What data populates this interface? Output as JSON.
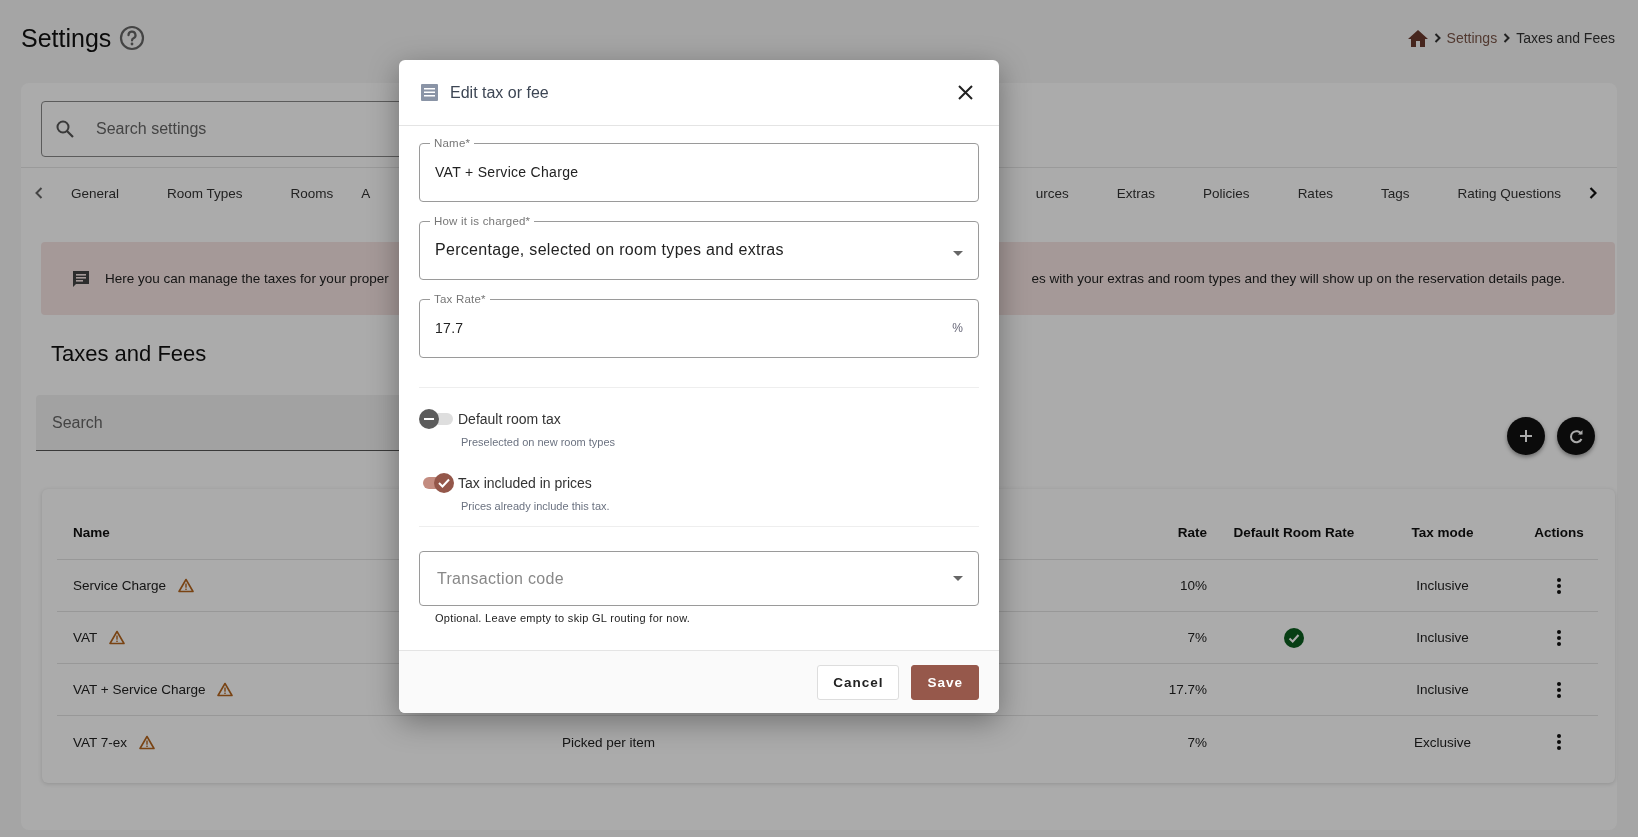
{
  "page": {
    "title": "Settings",
    "breadcrumb": [
      {
        "label": "Settings",
        "current": false
      },
      {
        "label": "Taxes and Fees",
        "current": true
      }
    ]
  },
  "settings_search": {
    "placeholder": "Search settings"
  },
  "tabs": {
    "left": [
      {
        "label": "General"
      },
      {
        "label": "Room Types"
      },
      {
        "label": "Rooms"
      },
      {
        "label": "A"
      }
    ],
    "right": [
      {
        "label": "urces"
      },
      {
        "label": "Extras"
      },
      {
        "label": "Policies"
      },
      {
        "label": "Rates"
      },
      {
        "label": "Tags"
      },
      {
        "label": "Rating Questions"
      }
    ]
  },
  "info_banner": {
    "text_parts": [
      "Here you can manage the taxes for your proper",
      "es with your extras and room types and they will show up on the reservation details page."
    ]
  },
  "section_title": "Taxes and Fees",
  "table_search": {
    "placeholder": "Search"
  },
  "table": {
    "header": {
      "name": "Name",
      "rate": "Rate",
      "default_room_rate": "Default Room Rate",
      "tax_mode": "Tax mode",
      "actions": "Actions"
    },
    "rows": [
      {
        "name": "Service Charge",
        "rate": "10%",
        "default_room_rate": false,
        "tax_mode": "Inclusive"
      },
      {
        "name": "VAT",
        "rate": "7%",
        "default_room_rate": true,
        "tax_mode": "Inclusive"
      },
      {
        "name": "VAT + Service Charge",
        "rate": "17.7%",
        "default_room_rate": false,
        "tax_mode": "Inclusive"
      },
      {
        "name": "VAT 7-ex",
        "column_2": "Picked per item",
        "rate": "7%",
        "default_room_rate": false,
        "tax_mode": "Exclusive"
      }
    ]
  },
  "dialog": {
    "title": "Edit tax or fee",
    "fields": [
      {
        "kind": "text",
        "label": "Name*",
        "value": "VAT + Service Charge"
      },
      {
        "kind": "select",
        "label": "How it is charged*",
        "value": "Percentage, selected on room types and extras"
      },
      {
        "kind": "text",
        "label": "Tax Rate*",
        "value": "17.7",
        "suffix": "%"
      }
    ],
    "toggles": [
      {
        "label": "Default room tax",
        "hint": "Preselected on new room types",
        "checked": false
      },
      {
        "label": "Tax included in prices",
        "hint": "Prices already include this tax.",
        "checked": true
      }
    ],
    "transaction_code": {
      "placeholder": "Transaction code",
      "helper": "Optional. Leave empty to skip GL routing for now."
    },
    "buttons": [
      {
        "label": "Cancel",
        "kind": "secondary"
      },
      {
        "label": "Save",
        "kind": "primary"
      }
    ]
  }
}
